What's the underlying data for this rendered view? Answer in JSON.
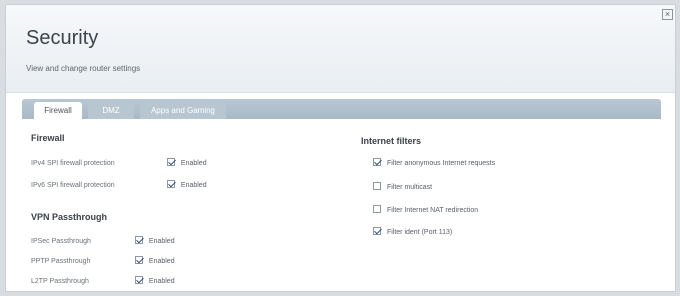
{
  "window": {
    "title": "Security",
    "subtitle": "View and change router settings",
    "close_label": "×"
  },
  "tabs": [
    {
      "label": "Firewall",
      "active": true
    },
    {
      "label": "DMZ",
      "active": false
    },
    {
      "label": "Apps and Gaming",
      "active": false
    }
  ],
  "firewall": {
    "title": "Firewall",
    "items": [
      {
        "label": "IPv4 SPI firewall protection",
        "checked": true,
        "status": "Enabled"
      },
      {
        "label": "IPv6 SPI firewall protection",
        "checked": true,
        "status": "Enabled"
      }
    ]
  },
  "vpn": {
    "title": "VPN Passthrough",
    "items": [
      {
        "label": "IPSec Passthrough",
        "checked": true,
        "status": "Enabled"
      },
      {
        "label": "PPTP Passthrough",
        "checked": true,
        "status": "Enabled"
      },
      {
        "label": "L2TP Passthrough",
        "checked": true,
        "status": "Enabled"
      }
    ]
  },
  "internet_filters": {
    "title": "Internet filters",
    "items": [
      {
        "label": "Filter anonymous Internet requests",
        "checked": true
      },
      {
        "label": "Filter multicast",
        "checked": false
      },
      {
        "label": "Filter Internet NAT redirection",
        "checked": false
      },
      {
        "label": "Filter ident (Port 113)",
        "checked": true
      }
    ]
  },
  "colors": {
    "tab_strip": "#b8c7d3",
    "checkmark": "#2f4f86",
    "background": "#d9dde1"
  }
}
